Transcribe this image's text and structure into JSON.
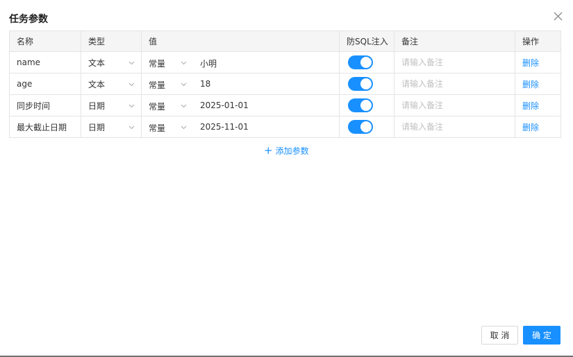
{
  "dialog": {
    "title": "任务参数"
  },
  "table": {
    "headers": [
      "名称",
      "类型",
      "值",
      "防SQL注入",
      "备注",
      "操作"
    ],
    "rows": [
      {
        "name": "name",
        "type": "文本",
        "value_type": "常量",
        "value": "小明",
        "sql_protect": true,
        "remark_placeholder": "请输入备注",
        "action": "删除"
      },
      {
        "name": "age",
        "type": "文本",
        "value_type": "常量",
        "value": "18",
        "sql_protect": true,
        "remark_placeholder": "请输入备注",
        "action": "删除"
      },
      {
        "name": "同步时间",
        "type": "日期",
        "value_type": "常量",
        "value": "2025-01-01",
        "sql_protect": true,
        "remark_placeholder": "请输入备注",
        "action": "删除"
      },
      {
        "name": "最大截止日期",
        "type": "日期",
        "value_type": "常量",
        "value": "2025-11-01",
        "sql_protect": true,
        "remark_placeholder": "请输入备注",
        "action": "删除"
      }
    ]
  },
  "add_param_label": "添加参数",
  "footer": {
    "cancel_label": "取 消",
    "ok_label": "确 定"
  },
  "colors": {
    "accent": "#1890ff",
    "header_bg": "#f5f5f5",
    "border": "#e4e4e4"
  },
  "icons": {
    "close": "close-icon",
    "chevron": "chevron-down-icon",
    "plus": "plus-icon"
  }
}
